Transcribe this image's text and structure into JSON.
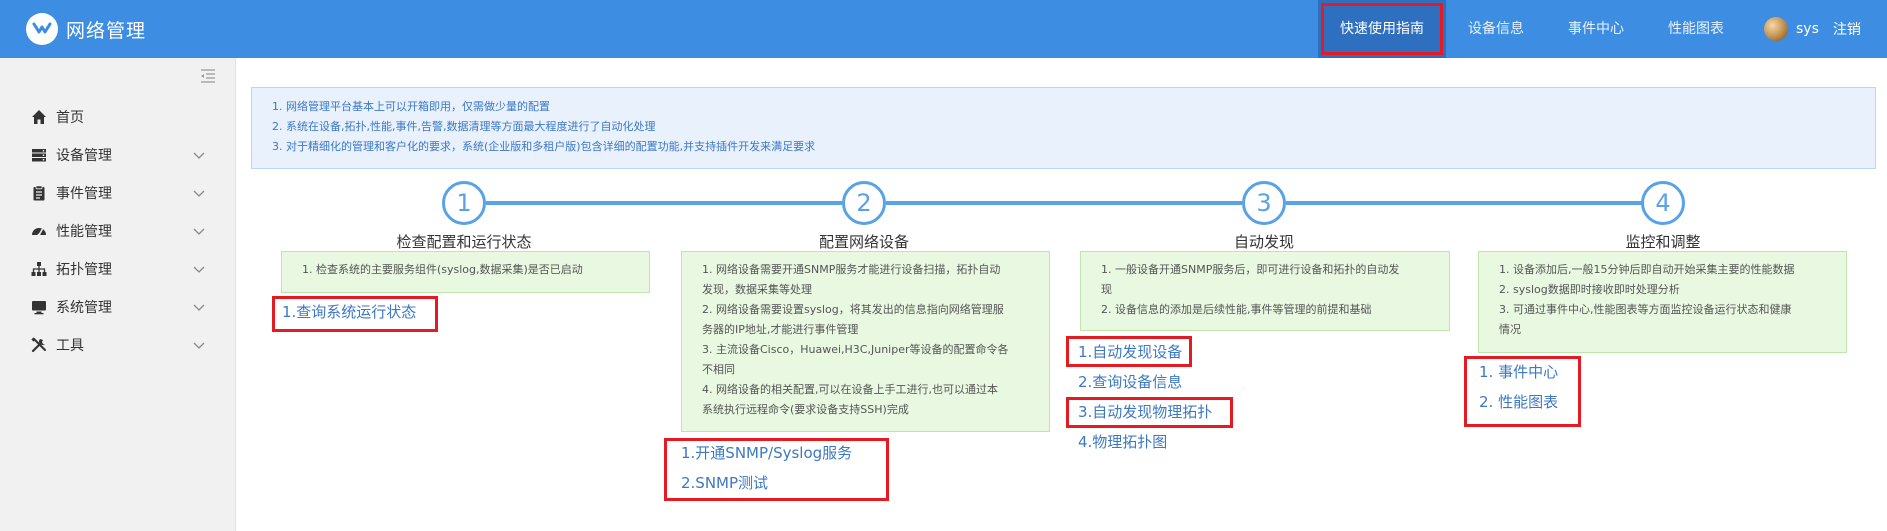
{
  "header": {
    "app_title": "网络管理",
    "nav": [
      {
        "label": "快速使用指南",
        "active": true
      },
      {
        "label": "设备信息"
      },
      {
        "label": "事件中心"
      },
      {
        "label": "性能图表"
      }
    ],
    "user": {
      "name": "sys",
      "logout": "注销"
    }
  },
  "sidebar": {
    "items": [
      {
        "label": "首页",
        "icon": "home-icon",
        "has_chevron": false
      },
      {
        "label": "设备管理",
        "icon": "server-icon",
        "has_chevron": true
      },
      {
        "label": "事件管理",
        "icon": "clipboard-icon",
        "has_chevron": true
      },
      {
        "label": "性能管理",
        "icon": "dashboard-icon",
        "has_chevron": true
      },
      {
        "label": "拓扑管理",
        "icon": "sitemap-icon",
        "has_chevron": true
      },
      {
        "label": "系统管理",
        "icon": "monitor-icon",
        "has_chevron": true
      },
      {
        "label": "工具",
        "icon": "tools-icon",
        "has_chevron": true
      }
    ]
  },
  "notice": {
    "lines": [
      "1. 网络管理平台基本上可以开箱即用，仅需做少量的配置",
      "2. 系统在设备,拓扑,性能,事件,告警,数据清理等方面最大程度进行了自动化处理",
      "3. 对于精细化的管理和客户化的要求，系统(企业版和多租户版)包含详细的配置功能,并支持插件开发来满足要求"
    ]
  },
  "steps": [
    {
      "number": "1",
      "title": "检查配置和运行状态",
      "box_lines": [
        "1. 检查系统的主要服务组件(syslog,数据采集)是否已启动"
      ],
      "links": [
        "1.查询系统运行状态"
      ]
    },
    {
      "number": "2",
      "title": "配置网络设备",
      "box_lines": [
        "1. 网络设备需要开通SNMP服务才能进行设备扫描，拓扑自动",
        "发现，数据采集等处理",
        "2. 网络设备需要设置syslog，将其发出的信息指向网络管理服",
        "务器的IP地址,才能进行事件管理",
        "3. 主流设备Cisco，Huawei,H3C,Juniper等设备的配置命令各",
        "不相同",
        "4. 网络设备的相关配置,可以在设备上手工进行,也可以通过本",
        "系统执行远程命令(要求设备支持SSH)完成"
      ],
      "links": [
        "1.开通SNMP/Syslog服务",
        "2.SNMP测试"
      ]
    },
    {
      "number": "3",
      "title": "自动发现",
      "box_lines": [
        "1. 一般设备开通SNMP服务后，即可进行设备和拓扑的自动发",
        "现",
        "2. 设备信息的添加是后续性能,事件等管理的前提和基础"
      ],
      "links": [
        "1.自动发现设备",
        "2.查询设备信息",
        "3.自动发现物理拓扑",
        "4.物理拓扑图"
      ]
    },
    {
      "number": "4",
      "title": "监控和调整",
      "box_lines": [
        "1. 设备添加后,一般15分钟后即自动开始采集主要的性能数据",
        "2. syslog数据即时接收即时处理分析",
        "3. 可通过事件中心,性能图表等方面监控设备运行状态和健康",
        "情况"
      ],
      "links": [
        "1. 事件中心",
        "2. 性能图表"
      ]
    }
  ],
  "colors": {
    "header_bg": "#3d8de3",
    "accent": "#5aa2e8",
    "highlight_border": "#e41b23",
    "notice_text": "#3c78c4",
    "step_box_bg": "#e8f8e1"
  }
}
